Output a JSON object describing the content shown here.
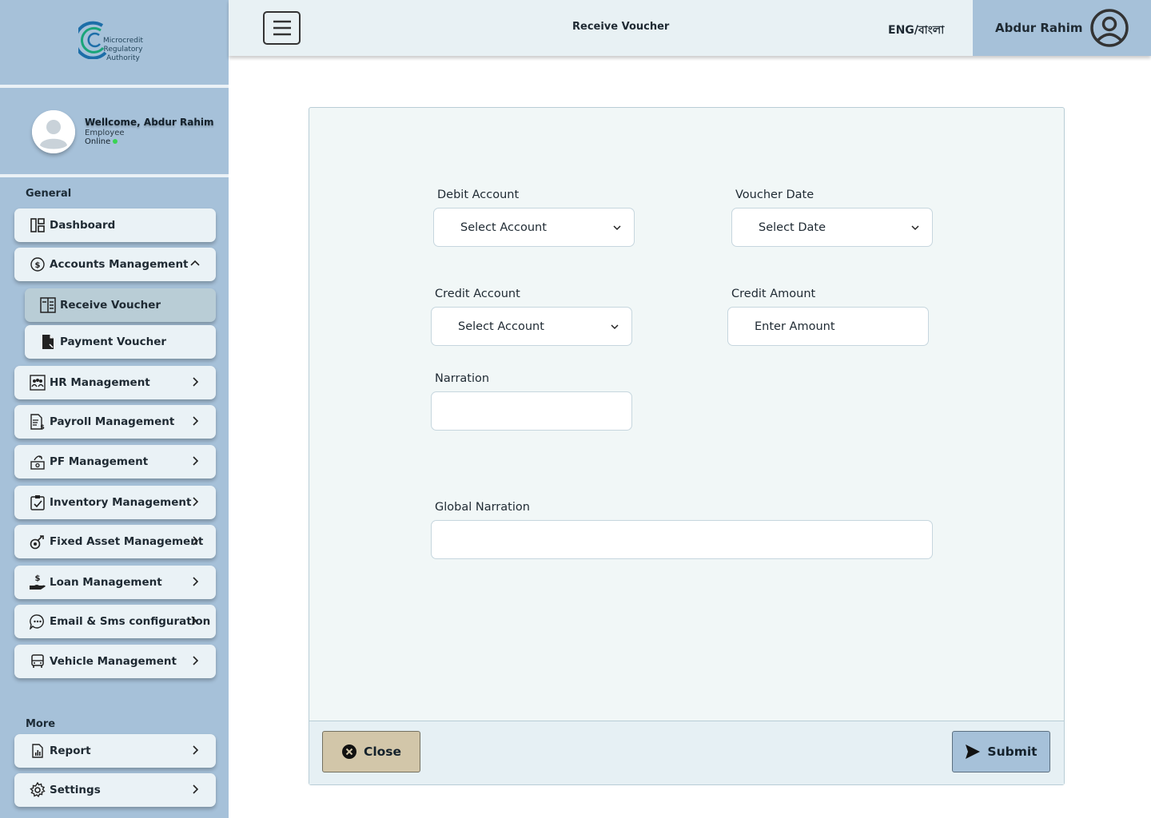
{
  "brand": {
    "logo_text": [
      "Microcredit",
      "Regulatory",
      "Authority"
    ]
  },
  "profile": {
    "welcome": "Wellcome, Abdur Rahim",
    "role": "Employee",
    "status": "Online"
  },
  "sidebar": {
    "general_label": "General",
    "more_label": "More",
    "items": [
      {
        "label": "Dashboard",
        "icon": "dashboard-icon"
      },
      {
        "label": "Accounts Management",
        "icon": "dollar-circle-icon",
        "expanded": true
      },
      {
        "label": "Receive Voucher",
        "icon": "receipt-icon",
        "active": true
      },
      {
        "label": "Payment Voucher",
        "icon": "document-icon"
      },
      {
        "label": "HR Management",
        "icon": "people-icon"
      },
      {
        "label": "Payroll Management",
        "icon": "payroll-icon"
      },
      {
        "label": "PF Management",
        "icon": "fund-icon"
      },
      {
        "label": "Inventory Management",
        "icon": "clipboard-check-icon"
      },
      {
        "label": "Fixed Asset Management",
        "icon": "asset-icon"
      },
      {
        "label": "Loan Management",
        "icon": "loan-hand-icon"
      },
      {
        "label": "Email & Sms configuration",
        "icon": "chat-icon"
      },
      {
        "label": "Vehicle Management",
        "icon": "bus-icon"
      }
    ],
    "more_items": [
      {
        "label": "Report",
        "icon": "report-icon"
      },
      {
        "label": "Settings",
        "icon": "gear-icon"
      }
    ]
  },
  "header": {
    "title": "Receive Voucher",
    "language": "ENG/বাংলা",
    "user_name": "Abdur Rahim"
  },
  "form": {
    "debit_account": {
      "label": "Debit Account",
      "value": "Select Account"
    },
    "voucher_date": {
      "label": "Voucher Date",
      "value": "Select Date"
    },
    "credit_account": {
      "label": "Credit Account",
      "value": "Select Account"
    },
    "credit_amount": {
      "label": "Credit Amount",
      "placeholder": "Enter Amount"
    },
    "narration": {
      "label": "Narration",
      "value": ""
    },
    "global_narration": {
      "label": "Global Narration",
      "value": ""
    },
    "close_label": "Close",
    "submit_label": "Submit"
  },
  "colors": {
    "sidebar": "#a6c1d9",
    "header": "#e8f1f4",
    "card": "#f1f7f7",
    "close_button": "#d2c6a9",
    "submit_button": "#a6c1d9",
    "online": "#39d353"
  }
}
